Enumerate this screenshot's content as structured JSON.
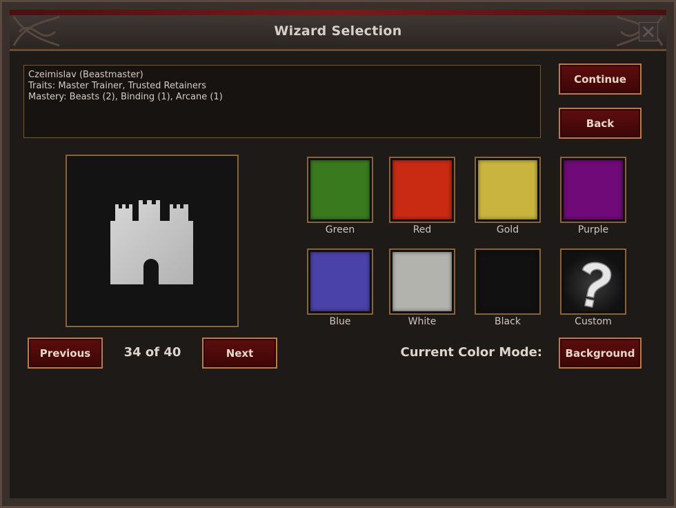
{
  "window": {
    "title": "Wizard Selection",
    "close_icon": "close-icon"
  },
  "info": {
    "lines": [
      "Czeimislav (Beastmaster)",
      "Traits: Master Trainer, Trusted Retainers",
      "Mastery: Beasts (2), Binding (1), Arcane (1)"
    ]
  },
  "buttons": {
    "continue": "Continue",
    "back": "Back",
    "previous": "Previous",
    "next": "Next",
    "color_mode": "Background"
  },
  "navigation": {
    "counter": "34 of 40"
  },
  "color_mode": {
    "label": "Current Color Mode:"
  },
  "emblem": {
    "icon": "castle-icon",
    "color": "#c8c8c8"
  },
  "swatches": [
    {
      "label": "Green",
      "color": "#3a7a1f"
    },
    {
      "label": "Red",
      "color": "#c92a12"
    },
    {
      "label": "Gold",
      "color": "#c9b43f"
    },
    {
      "label": "Purple",
      "color": "#6f0a78"
    },
    {
      "label": "Blue",
      "color": "#4a42a8"
    },
    {
      "label": "White",
      "color": "#b3b3ad"
    },
    {
      "label": "Black",
      "color": "#111111"
    },
    {
      "label": "Custom",
      "color": "#2a2a2a",
      "icon": "question-mark-icon"
    }
  ]
}
